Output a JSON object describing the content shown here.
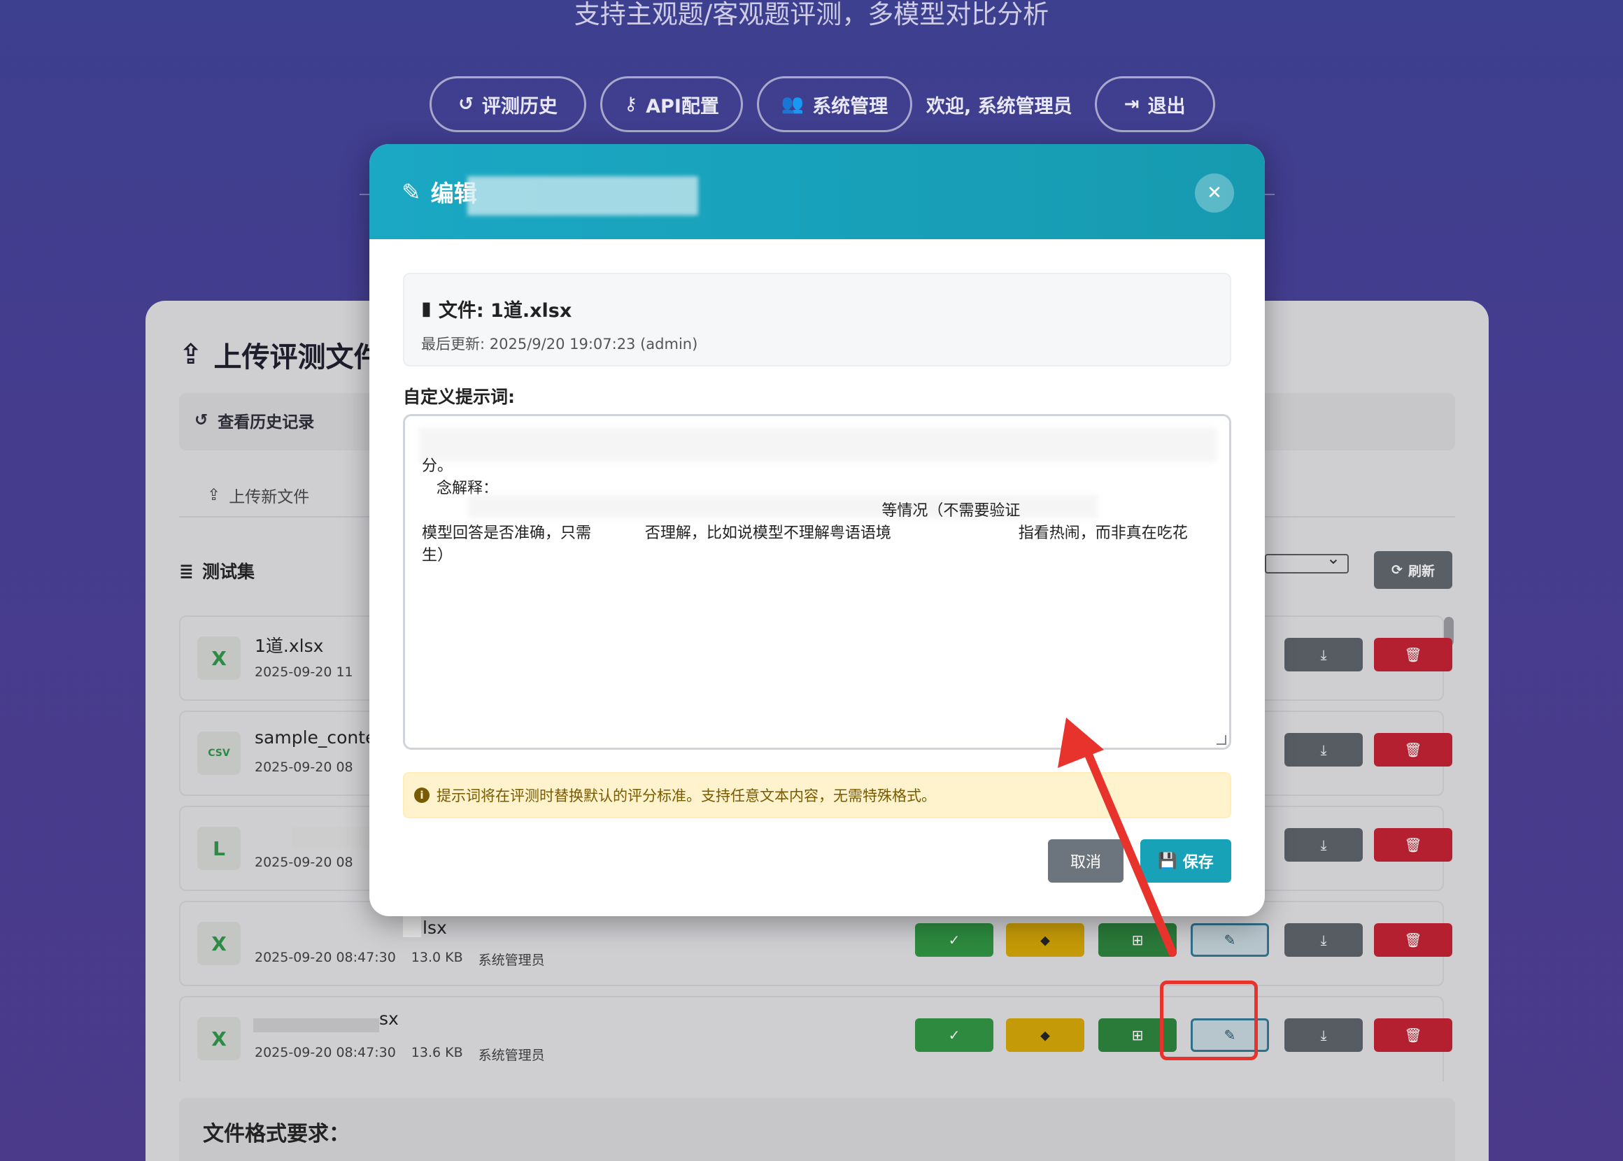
{
  "header": {
    "subtitle": "支持主观题/客观题评测，多模型对比分析",
    "nav": {
      "history": "评测历史",
      "api": "API配置",
      "system": "系统管理",
      "welcome": "欢迎, 系统管理员",
      "logout": "退出"
    }
  },
  "panel": {
    "title": "上传评测文件",
    "toolbar": {
      "view_history": "查看历史记录"
    },
    "tabs": {
      "upload": "上传新文件"
    },
    "section": "测试集",
    "refresh": "刷新",
    "files": [
      {
        "name": "1道.xlsx",
        "date": "2025-09-20 11",
        "size": "",
        "owner": "",
        "icon": "file-excel-icon"
      },
      {
        "name": "sample_conte",
        "date": "2025-09-20 08",
        "size": "",
        "owner": "",
        "icon": "file-csv-icon"
      },
      {
        "name": "",
        "date": "2025-09-20 08",
        "size": "",
        "owner": "",
        "icon": "file-excel-icon"
      },
      {
        "name": "lsx",
        "date": "2025-09-20 08:47:30",
        "size": "13.0 KB",
        "owner": "系统管理员",
        "icon": "file-excel-icon"
      },
      {
        "name": "sx",
        "date": "2025-09-20 08:47:30",
        "size": "13.6 KB",
        "owner": "系统管理员",
        "icon": "file-excel-icon"
      }
    ],
    "format_title": "文件格式要求："
  },
  "modal": {
    "title": "编辑",
    "file_label": "文件: 1道.xlsx",
    "updated": "最后更新: 2025/9/20 19:07:23 (admin)",
    "prompt_label": "自定义提示词:",
    "prompt_line1": "分。",
    "prompt_line2": "   念解释：",
    "prompt_line3": "                                                                                              等情况（不需要验证",
    "prompt_line4": "模型回答是否准确，只需           否理解，比如说模型不理解粤语语境                          指看热闹，而非真在吃花",
    "prompt_line5": "生）",
    "hint": "提示词将在评测时替换默认的评分标准。支持任意文本内容，无需特殊格式。",
    "cancel": "取消",
    "save": "保存"
  },
  "colors": {
    "modal_header": "#17a2b8",
    "save": "#17a2b8",
    "cancel": "#6c757d",
    "annotation": "#e8322c"
  }
}
